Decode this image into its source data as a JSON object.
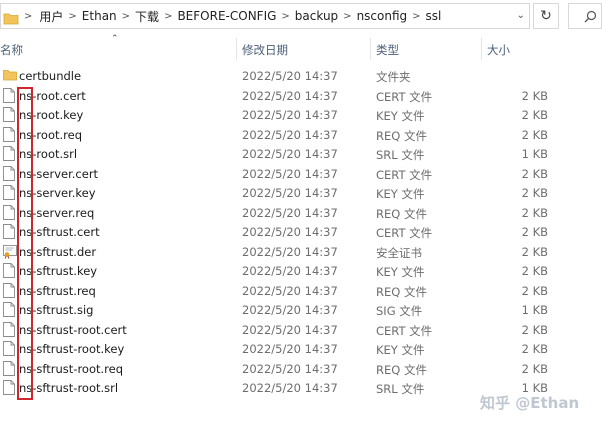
{
  "address": {
    "crumbs": [
      "用户",
      "Ethan",
      "下载",
      "BEFORE-CONFIG",
      "backup",
      "nsconfig",
      "ssl"
    ]
  },
  "columns": {
    "name": "名称",
    "date": "修改日期",
    "type": "类型",
    "size": "大小"
  },
  "files": [
    {
      "name": "certbundle",
      "date": "2022/5/20 14:37",
      "type": "文件夹",
      "size": "",
      "icon": "folder-icon"
    },
    {
      "name": "ns-root.cert",
      "date": "2022/5/20 14:37",
      "type": "CERT 文件",
      "size": "2 KB",
      "icon": "file-icon"
    },
    {
      "name": "ns-root.key",
      "date": "2022/5/20 14:37",
      "type": "KEY 文件",
      "size": "2 KB",
      "icon": "file-icon"
    },
    {
      "name": "ns-root.req",
      "date": "2022/5/20 14:37",
      "type": "REQ 文件",
      "size": "2 KB",
      "icon": "file-icon"
    },
    {
      "name": "ns-root.srl",
      "date": "2022/5/20 14:37",
      "type": "SRL 文件",
      "size": "1 KB",
      "icon": "file-icon"
    },
    {
      "name": "ns-server.cert",
      "date": "2022/5/20 14:37",
      "type": "CERT 文件",
      "size": "2 KB",
      "icon": "file-icon"
    },
    {
      "name": "ns-server.key",
      "date": "2022/5/20 14:37",
      "type": "KEY 文件",
      "size": "2 KB",
      "icon": "file-icon"
    },
    {
      "name": "ns-server.req",
      "date": "2022/5/20 14:37",
      "type": "REQ 文件",
      "size": "2 KB",
      "icon": "file-icon"
    },
    {
      "name": "ns-sftrust.cert",
      "date": "2022/5/20 14:37",
      "type": "CERT 文件",
      "size": "2 KB",
      "icon": "file-icon"
    },
    {
      "name": "ns-sftrust.der",
      "date": "2022/5/20 14:37",
      "type": "安全证书",
      "size": "2 KB",
      "icon": "certificate-icon"
    },
    {
      "name": "ns-sftrust.key",
      "date": "2022/5/20 14:37",
      "type": "KEY 文件",
      "size": "2 KB",
      "icon": "file-icon"
    },
    {
      "name": "ns-sftrust.req",
      "date": "2022/5/20 14:37",
      "type": "REQ 文件",
      "size": "2 KB",
      "icon": "file-icon"
    },
    {
      "name": "ns-sftrust.sig",
      "date": "2022/5/20 14:37",
      "type": "SIG 文件",
      "size": "1 KB",
      "icon": "file-icon"
    },
    {
      "name": "ns-sftrust-root.cert",
      "date": "2022/5/20 14:37",
      "type": "CERT 文件",
      "size": "2 KB",
      "icon": "file-icon"
    },
    {
      "name": "ns-sftrust-root.key",
      "date": "2022/5/20 14:37",
      "type": "KEY 文件",
      "size": "2 KB",
      "icon": "file-icon"
    },
    {
      "name": "ns-sftrust-root.req",
      "date": "2022/5/20 14:37",
      "type": "REQ 文件",
      "size": "2 KB",
      "icon": "file-icon"
    },
    {
      "name": "ns-sftrust-root.srl",
      "date": "2022/5/20 14:37",
      "type": "SRL 文件",
      "size": "1 KB",
      "icon": "file-icon"
    }
  ],
  "watermark": "知乎 @Ethan",
  "colors": {
    "highlight": "#d0262b",
    "folder": "#f2c55c",
    "header_text": "#4c607a"
  }
}
